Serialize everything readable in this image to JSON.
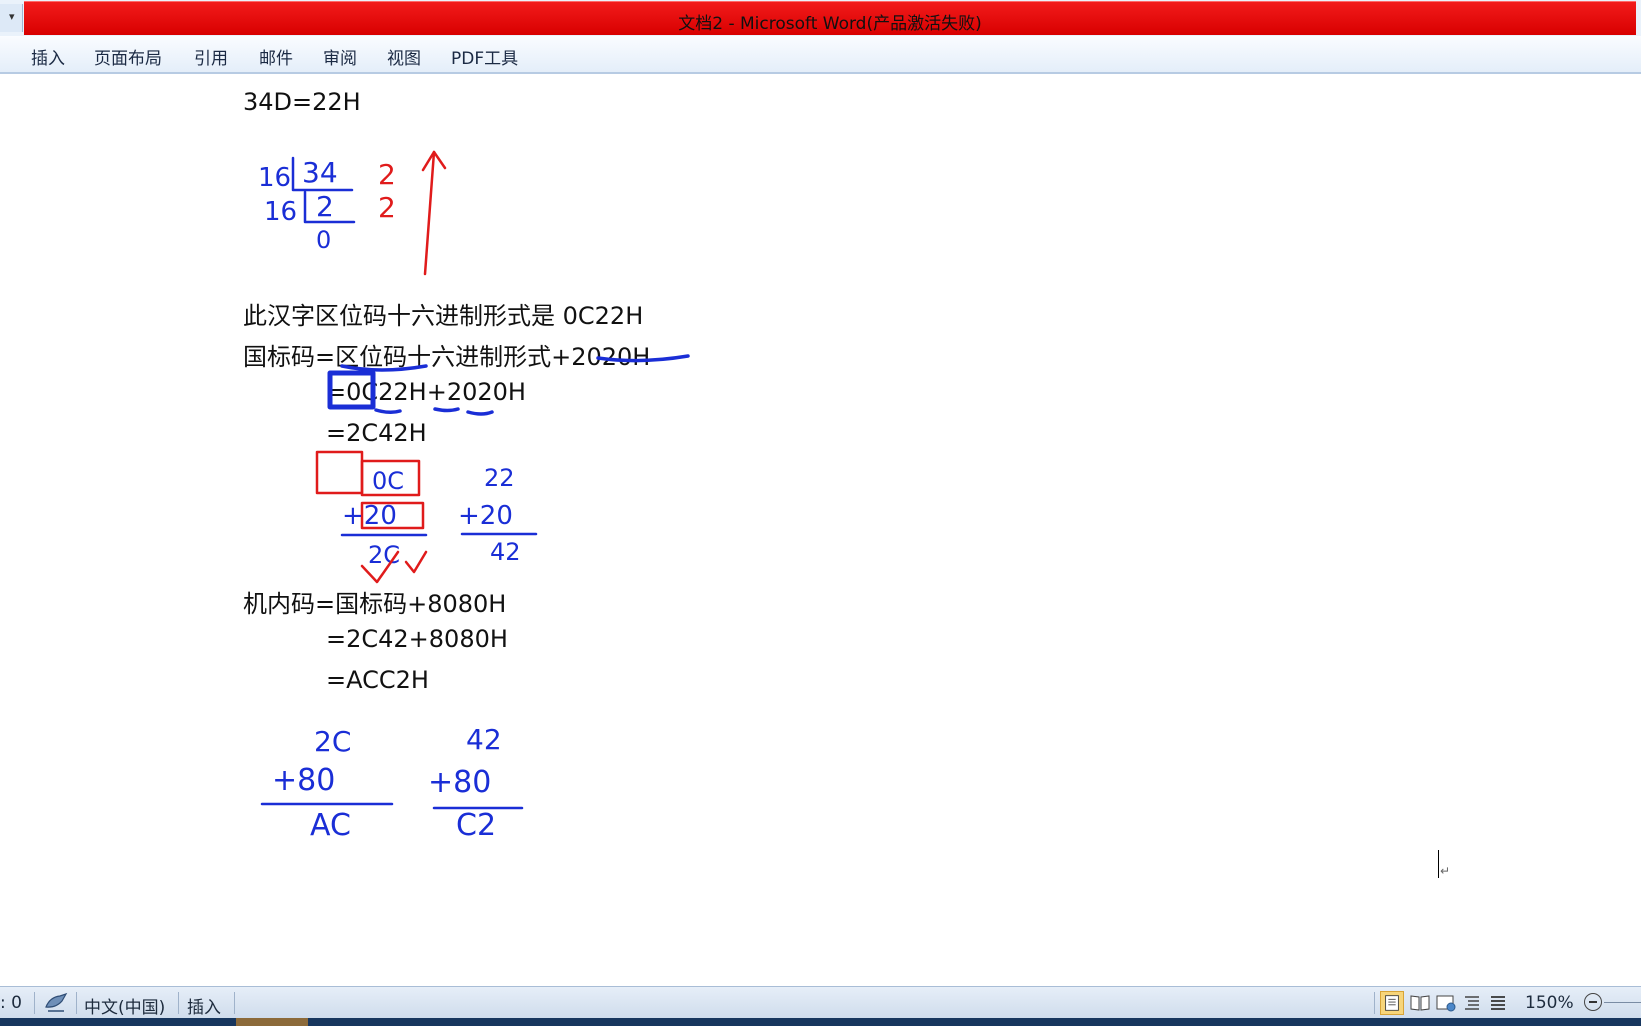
{
  "window": {
    "title": "文档2 - Microsoft Word(产品激活失败)"
  },
  "ribbon": {
    "tabs": [
      "插入",
      "页面布局",
      "引用",
      "邮件",
      "审阅",
      "视图",
      "PDF工具"
    ]
  },
  "document": {
    "lines": [
      "34D=22H",
      "此汉字区位码十六进制形式是 0C22H",
      "国标码=区位码十六进制形式+2020H",
      "=0C22H+2020H",
      "=2C42H",
      "机内码=国标码+8080H",
      "=2C42+8080H",
      "=ACC2H"
    ],
    "handwriting": {
      "division": {
        "divisor_1": "16",
        "dividend_1": "34",
        "remainder_1": "2",
        "divisor_2": "16",
        "quotient_1": "2",
        "remainder_2": "2",
        "quotient_2": "0"
      },
      "sum_1": {
        "top": "0C",
        "bottom": "+20",
        "result": "2C"
      },
      "sum_2": {
        "top": "22",
        "bottom": "+20",
        "result": "42"
      },
      "sum_3": {
        "top": "2C",
        "bottom": "+80",
        "result": "AC"
      },
      "sum_4": {
        "top": "42",
        "bottom": "+80",
        "result": "C2"
      }
    }
  },
  "status": {
    "word_count": ": 0",
    "language": "中文(中国)",
    "mode": "插入",
    "zoom": "150%"
  },
  "colors": {
    "title_bar": "#e00000",
    "ink_blue": "#1a2ed6",
    "ink_red": "#e01b1b"
  }
}
